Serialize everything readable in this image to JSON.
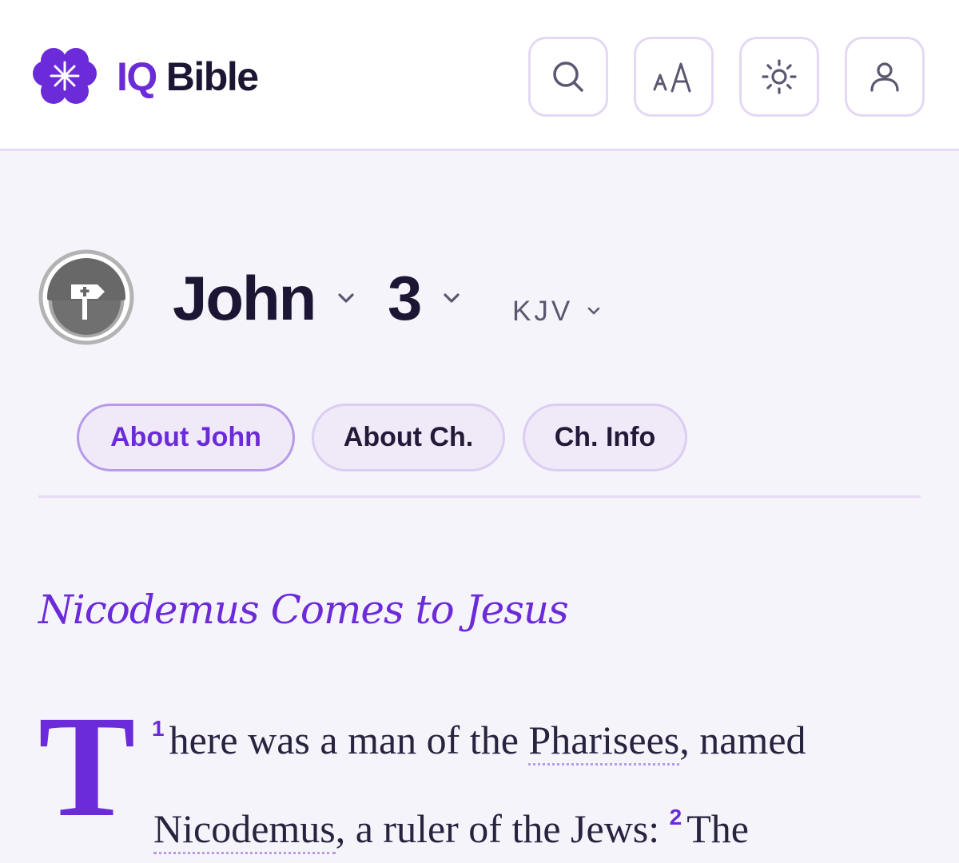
{
  "app": {
    "brand_prefix": "IQ",
    "brand_name": "Bible"
  },
  "header": {
    "buttons": [
      {
        "icon": "search-icon"
      },
      {
        "icon": "font-size-icon"
      },
      {
        "icon": "sun-icon"
      },
      {
        "icon": "user-icon"
      }
    ]
  },
  "selector": {
    "book_icon": "signpost-icon",
    "book": "John",
    "chapter": "3",
    "version": "KJV"
  },
  "tabs": [
    {
      "label": "About John",
      "active": true
    },
    {
      "label": "About Ch."
    },
    {
      "label": "Ch. Info"
    }
  ],
  "reading": {
    "section_heading": "Nicodemus Comes to Jesus",
    "drop_cap": "T",
    "verses": [
      {
        "number": "1",
        "segments": [
          "here was a man of the ",
          "Pharisees",
          ", named",
          "Nicodemus",
          ", a ruler of the Jews:"
        ]
      },
      {
        "number": "2",
        "segments": [
          "The"
        ]
      }
    ]
  },
  "colors": {
    "accent": "#6c2bd9",
    "background": "#f6f4fb",
    "text": "#1c1533",
    "border": "#e4d8f5"
  }
}
